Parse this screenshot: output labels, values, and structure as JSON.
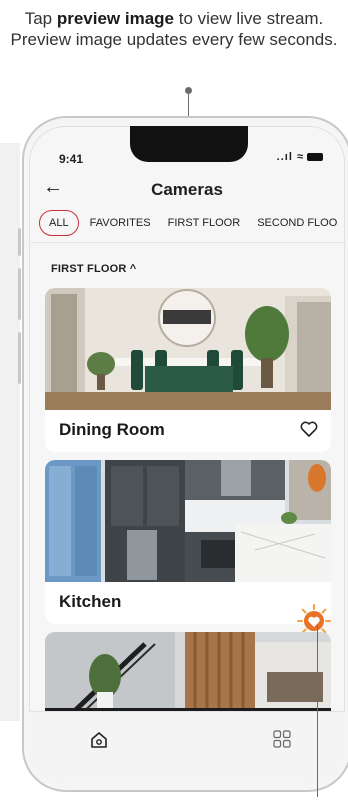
{
  "callout": {
    "pre": "Tap ",
    "bold": "preview image",
    "post": " to view live stream. Preview image updates every few seconds."
  },
  "status_bar": {
    "time": "9:41",
    "signal": "..ıl ≈"
  },
  "header": {
    "back_icon": "back-arrow-icon",
    "title": "Cameras"
  },
  "tabs": [
    {
      "label": "ALL",
      "active": true
    },
    {
      "label": "FAVORITES",
      "active": false
    },
    {
      "label": "FIRST FLOOR",
      "active": false
    },
    {
      "label": "SECOND FLOO",
      "active": false
    }
  ],
  "section": {
    "title": "FIRST FLOOR",
    "chevron": "^"
  },
  "cameras": [
    {
      "name": "Dining Room",
      "favorite": false,
      "preview": "dining-room-preview-image"
    },
    {
      "name": "Kitchen",
      "favorite": true,
      "preview": "kitchen-preview-image"
    },
    {
      "name": "",
      "favorite": false,
      "preview": "living-area-preview-image"
    }
  ],
  "bottom_nav": {
    "left_icon": "home-icon",
    "right_icon": "grid-icon"
  },
  "colors": {
    "accent": "#c8303a",
    "favorite": "#e8722a",
    "background": "#f6f6f7"
  }
}
